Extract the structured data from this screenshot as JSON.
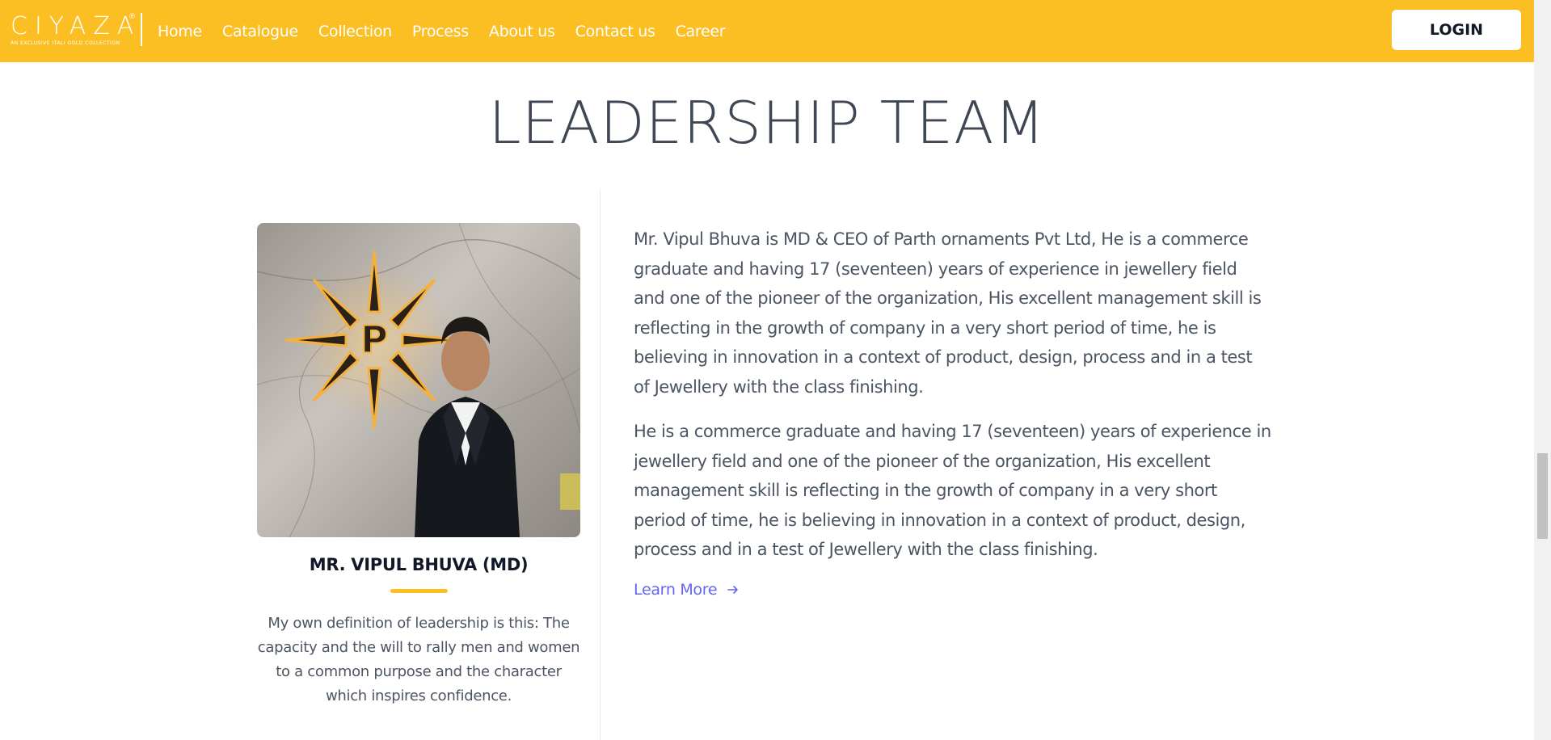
{
  "header": {
    "logo_word": "CIYAZA",
    "logo_tagline": "AN EXCLUSIVE ITALI GOLD COLLECTION",
    "logo_reg": "®",
    "nav": [
      {
        "label": "Home"
      },
      {
        "label": "Catalogue"
      },
      {
        "label": "Collection"
      },
      {
        "label": "Process"
      },
      {
        "label": "About us"
      },
      {
        "label": "Contact us"
      },
      {
        "label": "Career"
      }
    ],
    "login_label": "LOGIN"
  },
  "section": {
    "title": "LEADERSHIP TEAM"
  },
  "leader": {
    "photo_letter": "P",
    "name": "MR. VIPUL BHUVA (MD)",
    "quote": "My own definition of leadership is this: The capacity and the will to rally men and women to a common purpose and the character which inspires confidence.",
    "bio_paragraph_1": "Mr. Vipul Bhuva is MD & CEO of Parth ornaments Pvt Ltd, He is a commerce graduate and having 17 (seventeen) years of experience in jewellery field and one of the pioneer of the organization, His excellent management skill is reflecting in the growth of company in a very short period of time, he is believing in innovation in a context of product, design, process and in a test of Jewellery with the class finishing.",
    "bio_paragraph_2": "He is a commerce graduate and having 17 (seventeen) years of experience in jewellery field and one of the pioneer of the organization, His excellent management skill is reflecting in the growth of company in a very short period of time, he is believing in innovation in a context of product, design, process and in a test of Jewellery with the class finishing.",
    "learn_more_label": "Learn More"
  },
  "colors": {
    "header_bg": "#fbbf24",
    "accent_underline": "#fbbf24",
    "link": "#6366f1",
    "title": "#3f4654",
    "body_text": "#4b5563"
  }
}
